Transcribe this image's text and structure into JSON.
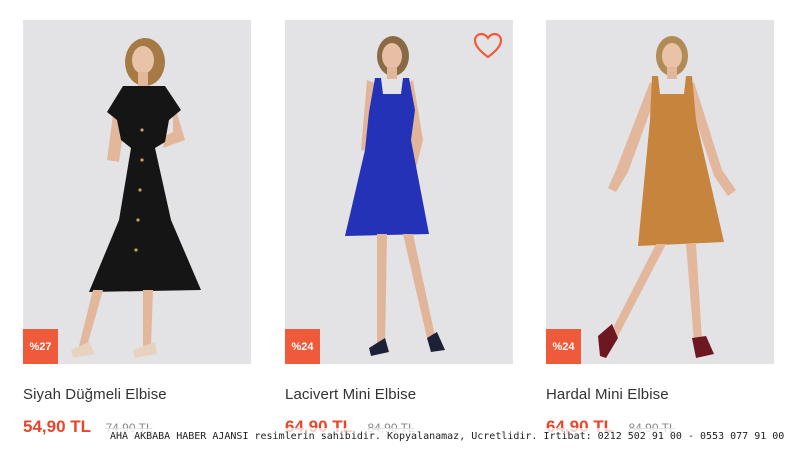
{
  "products": [
    {
      "name": "Siyah Düğmeli Elbise",
      "price": "54,90 TL",
      "old_price": "74,90 TL",
      "discount": "%27",
      "dress_color": "#151515"
    },
    {
      "name": "Lacivert Mini Elbise",
      "price": "64,90 TL",
      "old_price": "84,90 TL",
      "discount": "%24",
      "dress_color": "#2432b8"
    },
    {
      "name": "Hardal Mini Elbise",
      "price": "64,90 TL",
      "old_price": "84,90 TL",
      "discount": "%24",
      "dress_color": "#c7843c"
    }
  ],
  "favorite_icon": "heart-outline-icon",
  "accent_color": "#ef5a3a",
  "watermark": "AHA AKBABA HABER AJANSI resimlerin sahibidir. Kopyalanamaz, Ucretlidir. Irtibat: 0212 502 91 00  - 0553 077 91 00"
}
